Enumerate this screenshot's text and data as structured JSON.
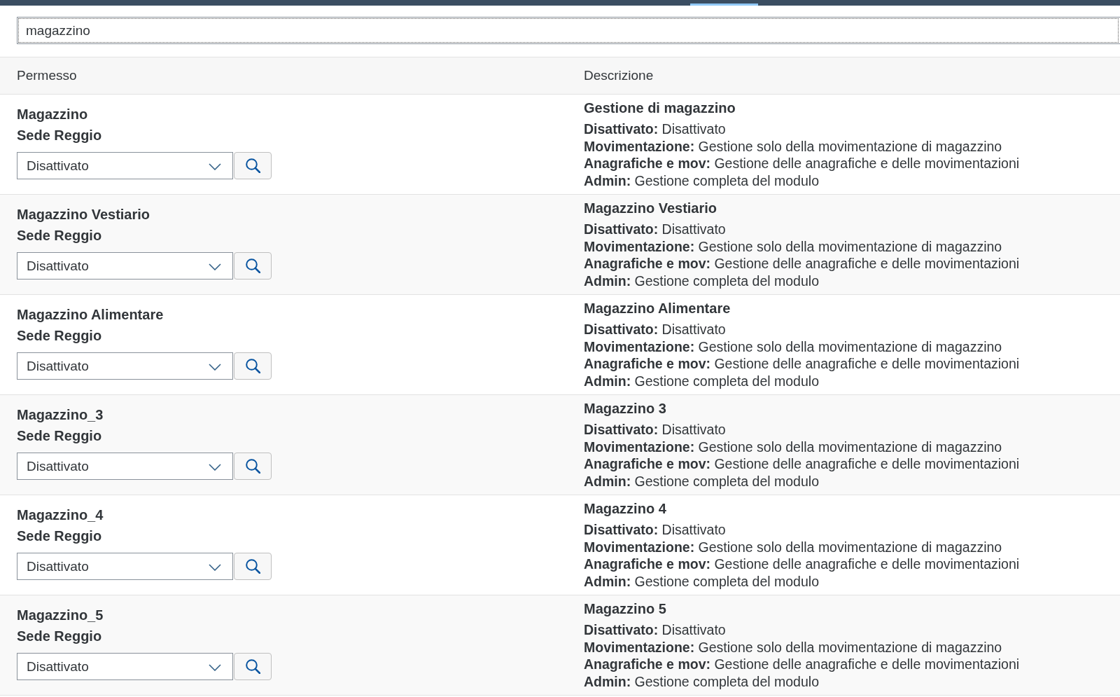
{
  "search": {
    "value": "magazzino"
  },
  "table": {
    "columns": [
      "Permesso",
      "Descrizione"
    ],
    "rows": [
      {
        "permission": "Magazzino",
        "site": "Sede Reggio",
        "access": "Disattivato",
        "description": {
          "title": "Gestione di magazzino",
          "lines": [
            "**Disattivato:** Disattivato",
            "**Movimentazione:** Gestione solo della movimentazione di magazzino",
            "**Anagrafiche e mov:** Gestione delle anagrafiche e delle movimentazioni",
            "**Admin:** Gestione completa del modulo"
          ]
        }
      },
      {
        "permission": "Magazzino Vestiario",
        "site": "Sede Reggio",
        "access": "Disattivato",
        "description": {
          "title": "Magazzino Vestiario",
          "lines": [
            "**Disattivato:** Disattivato",
            "**Movimentazione:** Gestione solo della movimentazione di magazzino",
            "**Anagrafiche e mov:** Gestione delle anagrafiche e delle movimentazioni",
            "**Admin:** Gestione completa del modulo"
          ]
        }
      },
      {
        "permission": "Magazzino Alimentare",
        "site": "Sede Reggio",
        "access": "Disattivato",
        "description": {
          "title": "Magazzino Alimentare",
          "lines": [
            "**Disattivato:** Disattivato",
            "**Movimentazione:** Gestione solo della movimentazione di magazzino",
            "**Anagrafiche e mov:** Gestione delle anagrafiche e delle movimentazioni",
            "**Admin:** Gestione completa del modulo"
          ]
        }
      },
      {
        "permission": "Magazzino_3",
        "site": "Sede Reggio",
        "access": "Disattivato",
        "description": {
          "title": "Magazzino 3",
          "lines": [
            "**Disattivato:** Disattivato",
            "**Movimentazione:** Gestione solo della movimentazione di magazzino",
            "**Anagrafiche e mov:** Gestione delle anagrafiche e delle movimentazioni",
            "**Admin:** Gestione completa del modulo"
          ]
        }
      },
      {
        "permission": "Magazzino_4",
        "site": "Sede Reggio",
        "access": "Disattivato",
        "description": {
          "title": "Magazzino 4",
          "lines": [
            "**Disattivato:** Disattivato",
            "**Movimentazione:** Gestione solo della movimentazione di magazzino",
            "**Anagrafiche e mov:** Gestione delle anagrafiche e delle movimentazioni",
            "**Admin:** Gestione completa del modulo"
          ]
        }
      },
      {
        "permission": "Magazzino_5",
        "site": "Sede Reggio",
        "access": "Disattivato",
        "description": {
          "title": "Magazzino 5",
          "lines": [
            "**Disattivato:** Disattivato",
            "**Movimentazione:** Gestione solo della movimentazione di magazzino",
            "**Anagrafiche e mov:** Gestione delle anagrafiche e delle movimentazioni",
            "**Admin:** Gestione completa del modulo"
          ]
        }
      }
    ]
  }
}
